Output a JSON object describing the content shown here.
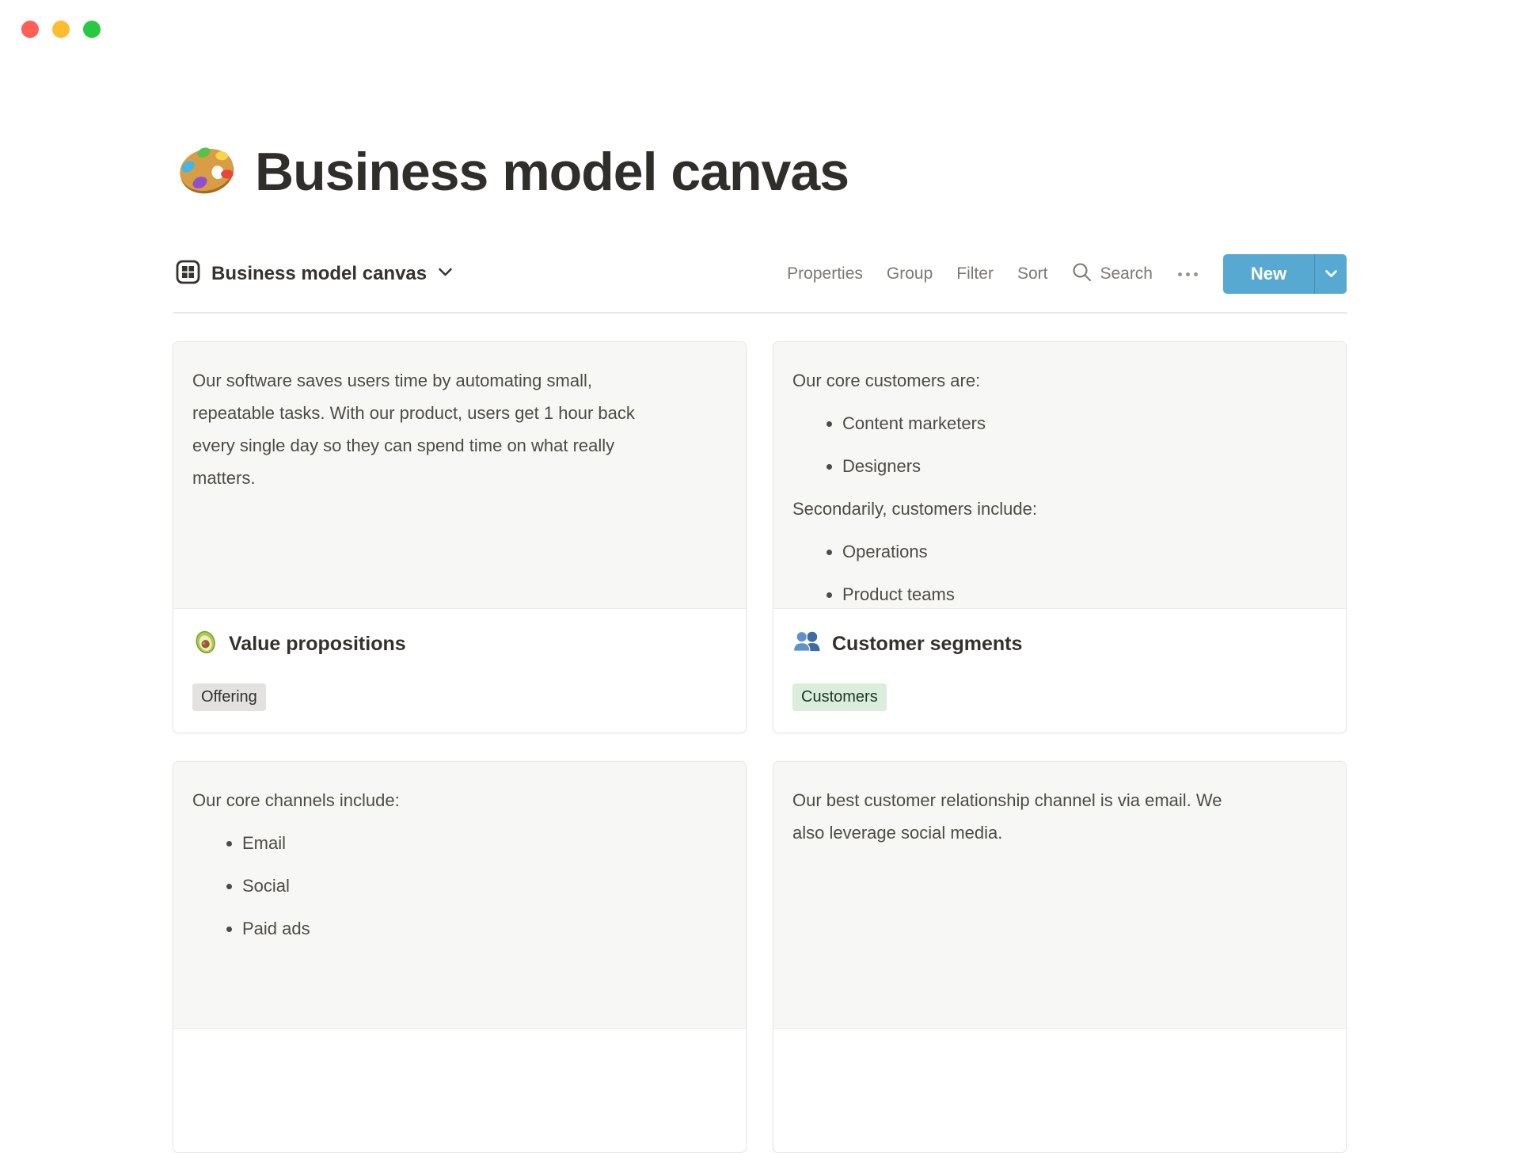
{
  "window": {
    "traffic_lights": [
      "#fe5f57",
      "#febc2e",
      "#28c840"
    ]
  },
  "page": {
    "title": "Business model canvas",
    "title_emoji": "artist-palette-emoji"
  },
  "view_bar": {
    "view_name": "Business model canvas",
    "menu_items": [
      "Properties",
      "Group",
      "Filter",
      "Sort"
    ],
    "search_label": "Search",
    "more_icon": "ellipsis-icon",
    "new_button": {
      "label": "New",
      "color": "#58a9d1"
    }
  },
  "cards": [
    {
      "title": "Value propositions",
      "emoji": "avocado-emoji",
      "tag": {
        "label": "Offering",
        "bg": "#e3e2e0",
        "color": "#32302c"
      },
      "content": [
        {
          "type": "p",
          "lines": [
            "Our software saves users time by automating small,",
            "repeatable tasks. With our product, users get 1 hour back",
            "every single day so they can spend time on what really",
            "matters."
          ]
        }
      ]
    },
    {
      "title": "Customer segments",
      "emoji": "busts-in-silhouette-emoji",
      "tag": {
        "label": "Customers",
        "bg": "#dbeddb",
        "color": "#1c3829"
      },
      "content": [
        {
          "type": "p",
          "lines": [
            "Our core customers are:"
          ]
        },
        {
          "type": "li",
          "text": "Content marketers"
        },
        {
          "type": "li",
          "text": "Designers"
        },
        {
          "type": "p",
          "lines": [
            "Secondarily, customers include:"
          ]
        },
        {
          "type": "li",
          "text": "Operations"
        },
        {
          "type": "li",
          "text": "Product teams"
        }
      ]
    },
    {
      "content": [
        {
          "type": "p",
          "lines": [
            "Our core channels include:"
          ]
        },
        {
          "type": "li",
          "text": "Email"
        },
        {
          "type": "li",
          "text": "Social"
        },
        {
          "type": "li",
          "text": "Paid ads"
        }
      ]
    },
    {
      "content": [
        {
          "type": "p",
          "lines": [
            "Our best customer relationship channel is via email. We",
            "also leverage social media."
          ]
        }
      ]
    }
  ]
}
